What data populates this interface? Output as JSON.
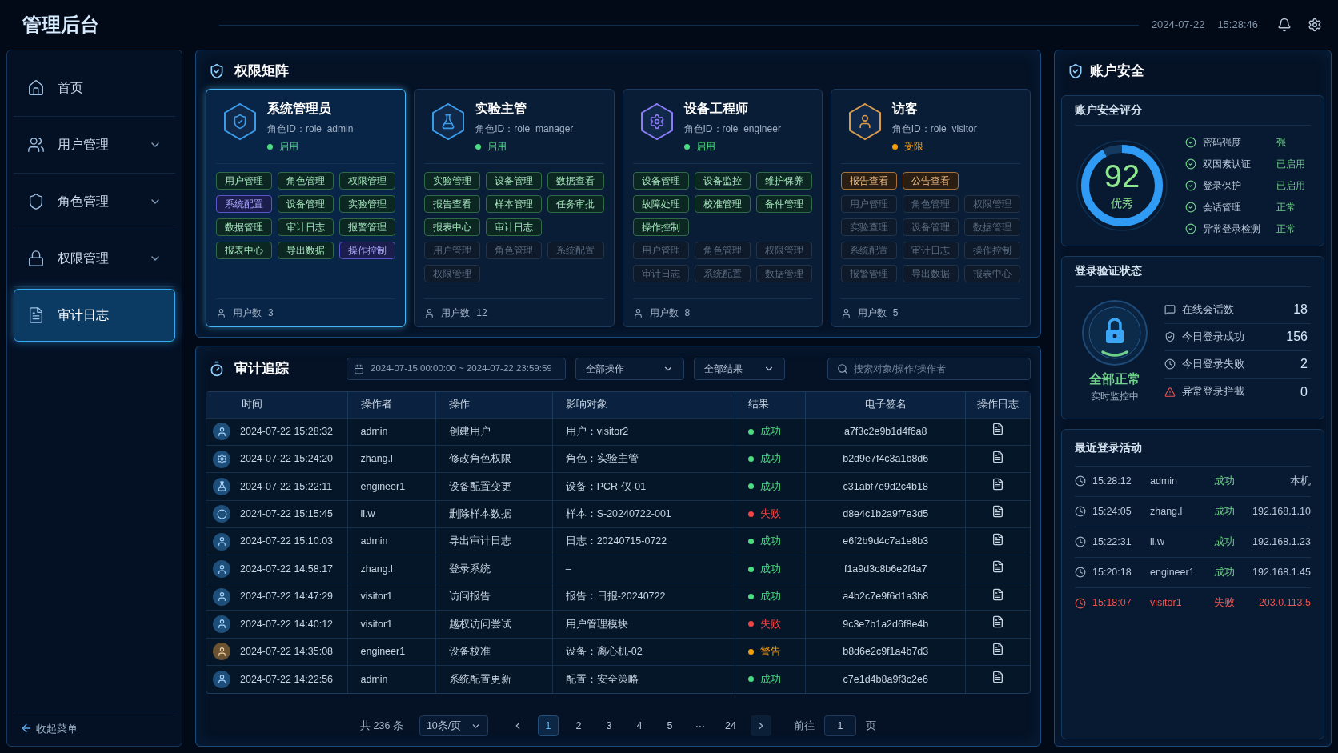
{
  "header": {
    "title": "管理后台",
    "date": "2024-07-22",
    "time": "15:28:46"
  },
  "sidebar": {
    "items": [
      {
        "label": "首页",
        "kind": "home",
        "expandable": false,
        "selected": false
      },
      {
        "label": "用户管理",
        "kind": "users",
        "expandable": true,
        "selected": false
      },
      {
        "label": "角色管理",
        "kind": "role",
        "expandable": true,
        "selected": false
      },
      {
        "label": "权限管理",
        "kind": "permission",
        "expandable": true,
        "selected": false
      },
      {
        "label": "审计日志",
        "kind": "log",
        "expandable": false,
        "selected": true
      }
    ],
    "collapse": "收起菜单"
  },
  "permission_matrix": {
    "title": "权限矩阵",
    "roles": [
      {
        "name": "系统管理员",
        "role_id": "角色ID：role_admin",
        "kind": "admin",
        "status": {
          "text": "启用",
          "color": "#4ade80"
        },
        "selected": true,
        "users_label": "用户数",
        "users": "3",
        "tags": [
          {
            "label": "用户管理",
            "kind": "granted"
          },
          {
            "label": "角色管理",
            "kind": "granted"
          },
          {
            "label": "权限管理",
            "kind": "granted"
          },
          {
            "label": "系统配置",
            "kind": "special"
          },
          {
            "label": "设备管理",
            "kind": "granted"
          },
          {
            "label": "实验管理",
            "kind": "granted"
          },
          {
            "label": "数据管理",
            "kind": "granted"
          },
          {
            "label": "审计日志",
            "kind": "granted"
          },
          {
            "label": "报警管理",
            "kind": "granted"
          },
          {
            "label": "报表中心",
            "kind": "granted"
          },
          {
            "label": "导出数据",
            "kind": "granted"
          },
          {
            "label": "操作控制",
            "kind": "special"
          }
        ]
      },
      {
        "name": "实验主管",
        "role_id": "角色ID：role_manager",
        "kind": "lab",
        "status": {
          "text": "启用",
          "color": "#4ade80"
        },
        "selected": false,
        "users_label": "用户数",
        "users": "12",
        "tags": [
          {
            "label": "实验管理",
            "kind": "granted"
          },
          {
            "label": "设备管理",
            "kind": "granted"
          },
          {
            "label": "数据查看",
            "kind": "granted"
          },
          {
            "label": "报告查看",
            "kind": "granted"
          },
          {
            "label": "样本管理",
            "kind": "granted"
          },
          {
            "label": "任务审批",
            "kind": "granted"
          },
          {
            "label": "报表中心",
            "kind": "granted"
          },
          {
            "label": "审计日志",
            "kind": "granted"
          },
          {
            "label": "用户管理",
            "kind": "denied"
          },
          {
            "label": "角色管理",
            "kind": "denied"
          },
          {
            "label": "系统配置",
            "kind": "denied"
          },
          {
            "label": "权限管理",
            "kind": "denied"
          }
        ]
      },
      {
        "name": "设备工程师",
        "role_id": "角色ID：role_engineer",
        "kind": "engineer",
        "status": {
          "text": "启用",
          "color": "#4ade80"
        },
        "selected": false,
        "users_label": "用户数",
        "users": "8",
        "tags": [
          {
            "label": "设备管理",
            "kind": "granted"
          },
          {
            "label": "设备监控",
            "kind": "granted"
          },
          {
            "label": "维护保养",
            "kind": "granted"
          },
          {
            "label": "故障处理",
            "kind": "granted"
          },
          {
            "label": "校准管理",
            "kind": "granted"
          },
          {
            "label": "备件管理",
            "kind": "granted"
          },
          {
            "label": "操作控制",
            "kind": "granted"
          },
          {
            "label": "用户管理",
            "kind": "denied"
          },
          {
            "label": "角色管理",
            "kind": "denied"
          },
          {
            "label": "权限管理",
            "kind": "denied"
          },
          {
            "label": "审计日志",
            "kind": "denied"
          },
          {
            "label": "系统配置",
            "kind": "denied"
          },
          {
            "label": "数据管理",
            "kind": "denied"
          }
        ]
      },
      {
        "name": "访客",
        "role_id": "角色ID：role_visitor",
        "kind": "visitor",
        "status": {
          "text": "受限",
          "color": "#f59e0b"
        },
        "selected": false,
        "users_label": "用户数",
        "users": "5",
        "tags": [
          {
            "label": "报告查看",
            "kind": "limited"
          },
          {
            "label": "公告查看",
            "kind": "limited"
          },
          {
            "label": "用户管理",
            "kind": "denied"
          },
          {
            "label": "角色管理",
            "kind": "denied"
          },
          {
            "label": "权限管理",
            "kind": "denied"
          },
          {
            "label": "实验查理",
            "kind": "denied"
          },
          {
            "label": "设备管理",
            "kind": "denied"
          },
          {
            "label": "数据管理",
            "kind": "denied"
          },
          {
            "label": "系统配置",
            "kind": "denied"
          },
          {
            "label": "审计日志",
            "kind": "denied"
          },
          {
            "label": "操作控制",
            "kind": "denied"
          },
          {
            "label": "报警管理",
            "kind": "denied"
          },
          {
            "label": "导出数据",
            "kind": "denied"
          },
          {
            "label": "报表中心",
            "kind": "denied"
          }
        ]
      }
    ]
  },
  "audit": {
    "title": "审计追踪",
    "date_range": "2024-07-15 00:00:00 ~ 2024-07-22 23:59:59",
    "operation_filter": "全部操作",
    "result_filter": "全部结果",
    "search": {
      "placeholder": "搜索对象/操作/操作者"
    },
    "table": {
      "columns": [
        "时间",
        "操作者",
        "操作",
        "影响对象",
        "结果",
        "电子签名",
        "操作日志"
      ],
      "rows": [
        {
          "kind": "user",
          "time": "2024-07-22 15:28:32",
          "operator": "admin",
          "action": "创建用户",
          "target": "用户：visitor2",
          "result": "成功",
          "color": "#4ade80",
          "signature": "a7f3c2e9b1d4f6a8"
        },
        {
          "kind": "gear",
          "time": "2024-07-22 15:24:20",
          "operator": "zhang.l",
          "action": "修改角色权限",
          "target": "角色：实验主管",
          "result": "成功",
          "color": "#4ade80",
          "signature": "b2d9e7f4c3a1b8d6"
        },
        {
          "kind": "flask",
          "time": "2024-07-22 15:22:11",
          "operator": "engineer1",
          "action": "设备配置变更",
          "target": "设备：PCR-仪-01",
          "result": "成功",
          "color": "#4ade80",
          "signature": "c31abf7e9d2c4b18"
        },
        {
          "kind": "ring",
          "time": "2024-07-22 15:15:45",
          "operator": "li.w",
          "action": "删除样本数据",
          "target": "样本：S-20240722-001",
          "result": "失败",
          "color": "#ef4444",
          "signature": "d8e4c1b2a9f7e3d5"
        },
        {
          "kind": "user",
          "time": "2024-07-22 15:10:03",
          "operator": "admin",
          "action": "导出审计日志",
          "target": "日志：20240715-0722",
          "result": "成功",
          "color": "#4ade80",
          "signature": "e6f2b9d4c7a1e8b3"
        },
        {
          "kind": "user",
          "time": "2024-07-22 14:58:17",
          "operator": "zhang.l",
          "action": "登录系统",
          "target": "–",
          "result": "成功",
          "color": "#4ade80",
          "signature": "f1a9d3c8b6e2f4a7"
        },
        {
          "kind": "user",
          "time": "2024-07-22 14:47:29",
          "operator": "visitor1",
          "action": "访问报告",
          "target": "报告：日报-20240722",
          "result": "成功",
          "color": "#4ade80",
          "signature": "a4b2c7e9f6d1a3b8"
        },
        {
          "kind": "user",
          "time": "2024-07-22 14:40:12",
          "operator": "visitor1",
          "action": "越权访问尝试",
          "target": "用户管理模块",
          "result": "失败",
          "color": "#ef4444",
          "signature": "9c3e7b1a2d6f8e4b"
        },
        {
          "kind": "warning",
          "time": "2024-07-22 14:35:08",
          "operator": "engineer1",
          "action": "设备校准",
          "target": "设备：离心机-02",
          "result": "警告",
          "color": "#f59e0b",
          "signature": "b8d6e2c9f1a4b7d3"
        },
        {
          "kind": "user",
          "time": "2024-07-22 14:22:56",
          "operator": "admin",
          "action": "系统配置更新",
          "target": "配置：安全策略",
          "result": "成功",
          "color": "#4ade80",
          "signature": "c7e1d4b8a9f3c2e6"
        }
      ]
    },
    "pagination": {
      "total": "共 236 条",
      "page_size": "10条/页",
      "pages": [
        {
          "label": "1",
          "selected": true
        },
        {
          "label": "2",
          "selected": false
        },
        {
          "label": "3",
          "selected": false
        },
        {
          "label": "4",
          "selected": false
        },
        {
          "label": "5",
          "selected": false
        },
        {
          "label": "···",
          "selected": false
        },
        {
          "label": "24",
          "selected": false
        }
      ],
      "goto_label": "前往",
      "goto_value": "1",
      "goto_suffix": "页"
    }
  },
  "account_security": {
    "title": "账户安全",
    "score": {
      "title": "账户安全评分",
      "value": "92",
      "grade": "优秀",
      "level": 0.92,
      "checks": [
        {
          "label": "密码强度",
          "value": "强"
        },
        {
          "label": "双因素认证",
          "value": "已启用"
        },
        {
          "label": "登录保护",
          "value": "已启用"
        },
        {
          "label": "会话管理",
          "value": "正常"
        },
        {
          "label": "异常登录检测",
          "value": "正常"
        }
      ]
    },
    "login_status": {
      "title": "登录验证状态",
      "state": "全部正常",
      "note": "实时监控中",
      "stats": [
        {
          "kind": "sessions",
          "label": "在线会话数",
          "value": "18"
        },
        {
          "kind": "success",
          "label": "今日登录成功",
          "value": "156"
        },
        {
          "kind": "failure",
          "label": "今日登录失败",
          "value": "2"
        },
        {
          "kind": "alert",
          "label": "异常登录拦截",
          "value": "0"
        }
      ]
    },
    "recent": {
      "title": "最近登录活动",
      "items": [
        {
          "time": "15:28:12",
          "user": "admin",
          "result": "成功",
          "source": "本机",
          "failed": false
        },
        {
          "time": "15:24:05",
          "user": "zhang.l",
          "result": "成功",
          "source": "192.168.1.10",
          "failed": false
        },
        {
          "time": "15:22:31",
          "user": "li.w",
          "result": "成功",
          "source": "192.168.1.23",
          "failed": false
        },
        {
          "time": "15:20:18",
          "user": "engineer1",
          "result": "成功",
          "source": "192.168.1.45",
          "failed": false
        },
        {
          "time": "15:18:07",
          "user": "visitor1",
          "result": "失败",
          "source": "203.0.113.5",
          "failed": true
        }
      ]
    }
  }
}
